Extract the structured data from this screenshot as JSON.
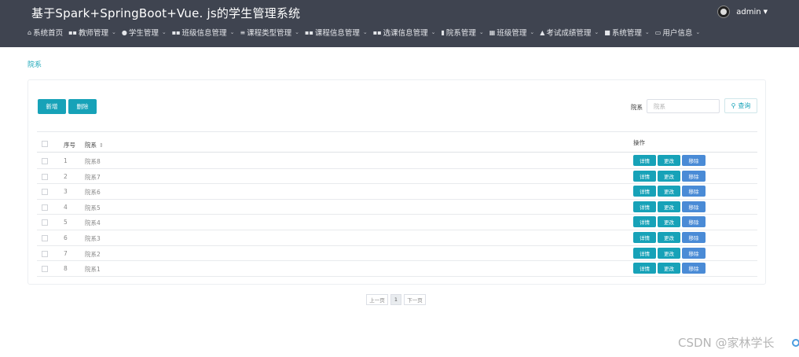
{
  "app": {
    "title": "基于Spark+SpringBoot+Vue. js的学生管理系统"
  },
  "user": {
    "name": "admin",
    "caret": "▼"
  },
  "nav": {
    "items": [
      {
        "icon": "⌂",
        "icon_name": "home-icon",
        "label": "系统首页",
        "caret": ""
      },
      {
        "icon": "▪▪",
        "icon_name": "grid-icon",
        "label": "教师管理",
        "caret": "⌄"
      },
      {
        "icon": "●",
        "icon_name": "user-circle-icon",
        "label": "学生管理",
        "caret": "⌄"
      },
      {
        "icon": "▪▪",
        "icon_name": "grid-icon",
        "label": "班级信息管理",
        "caret": "⌄"
      },
      {
        "icon": "≡",
        "icon_name": "list-icon",
        "label": "课程类型管理",
        "caret": "⌄"
      },
      {
        "icon": "▪▪",
        "icon_name": "grid-icon",
        "label": "课程信息管理",
        "caret": "⌄"
      },
      {
        "icon": "▪▪",
        "icon_name": "grid-icon",
        "label": "选课信息管理",
        "caret": "⌄"
      },
      {
        "icon": "▮",
        "icon_name": "building-icon",
        "label": "院系管理",
        "caret": "⌄"
      },
      {
        "icon": "▦",
        "icon_name": "table-icon",
        "label": "班级管理",
        "caret": "⌄"
      },
      {
        "icon": "▲",
        "icon_name": "exam-icon",
        "label": "考试成绩管理",
        "caret": "⌄"
      },
      {
        "icon": "■",
        "icon_name": "system-icon",
        "label": "系统管理",
        "caret": "⌄"
      },
      {
        "icon": "▭",
        "icon_name": "id-card-icon",
        "label": "用户信息",
        "caret": "⌄"
      }
    ]
  },
  "breadcrumb": "院系",
  "toolbar": {
    "add_label": "新增",
    "delete_label": "删除"
  },
  "search": {
    "label": "院系",
    "placeholder": "院系",
    "button_icon": "⚲",
    "button_label": "查询"
  },
  "table": {
    "headers": {
      "no": "序号",
      "name": "院系",
      "sort": "⇕",
      "ops": "操作"
    },
    "op_labels": {
      "detail": "详情",
      "edit": "更改",
      "remove": "移除"
    },
    "rows": [
      {
        "no": "1",
        "name": "院系8"
      },
      {
        "no": "2",
        "name": "院系7"
      },
      {
        "no": "3",
        "name": "院系6"
      },
      {
        "no": "4",
        "name": "院系5"
      },
      {
        "no": "5",
        "name": "院系4"
      },
      {
        "no": "6",
        "name": "院系3"
      },
      {
        "no": "7",
        "name": "院系2"
      },
      {
        "no": "8",
        "name": "院系1"
      }
    ]
  },
  "pagination": {
    "prev": "上一页",
    "current": "1",
    "next": "下一页"
  },
  "watermark": "CSDN @家林学长",
  "colors": {
    "header_bg": "#3f4450",
    "accent": "#17a2b8",
    "remove": "#4a8bd6"
  }
}
